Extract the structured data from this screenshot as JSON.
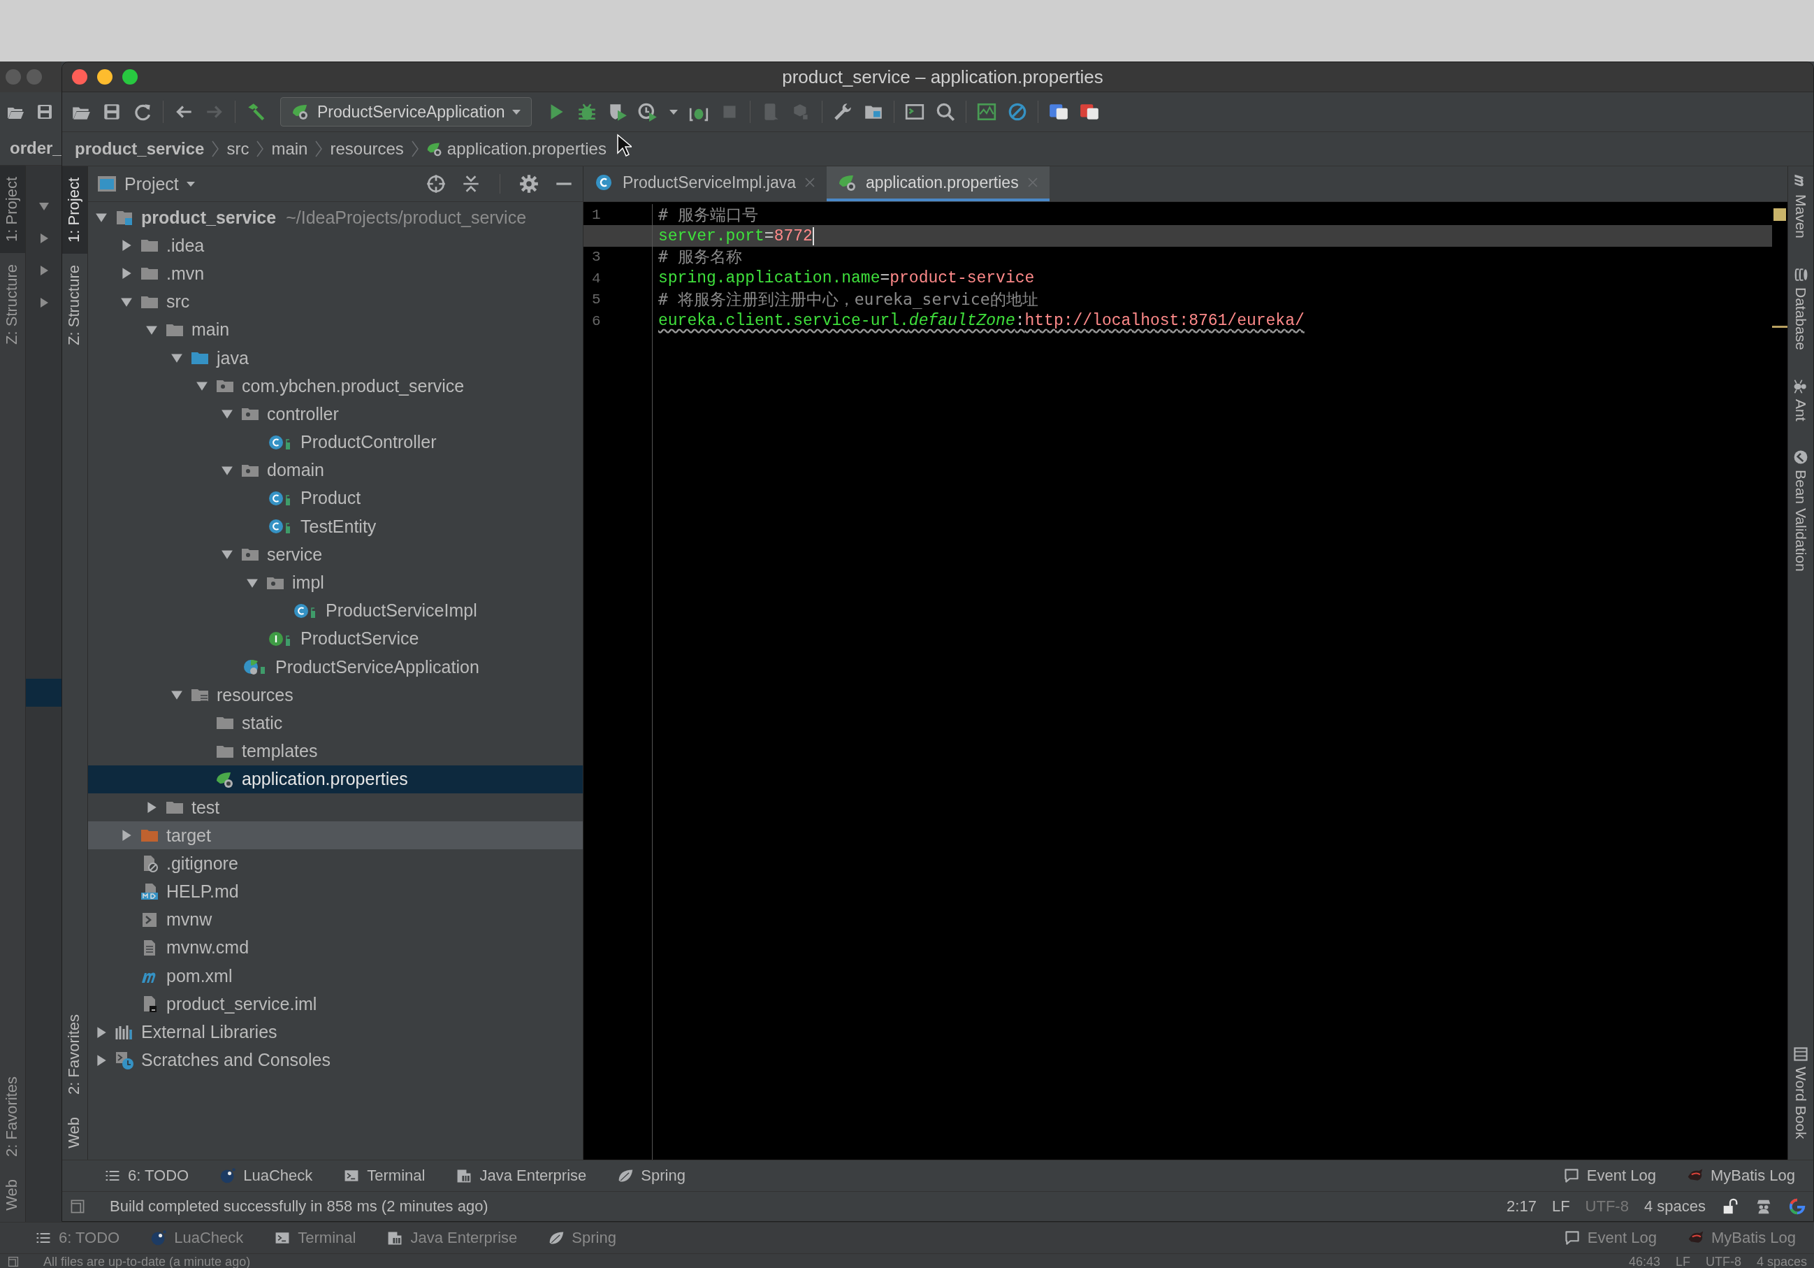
{
  "back_window": {
    "breadcrumb": "order_",
    "left_tool_tabs": [
      {
        "label": "1: Project",
        "selected": true
      },
      {
        "label": "Z: Structure",
        "selected": false
      }
    ],
    "left_tool_tabs_bottom": [
      {
        "label": "2: Favorites",
        "selected": false
      },
      {
        "label": "Web",
        "selected": false
      }
    ],
    "tool_buttons": [
      {
        "label": "6: TODO",
        "kind": "todo"
      },
      {
        "label": "LuaCheck",
        "kind": "lua"
      },
      {
        "label": "Terminal",
        "kind": "terminal"
      },
      {
        "label": "Java Enterprise",
        "kind": "enterprise"
      },
      {
        "label": "Spring",
        "kind": "spring"
      }
    ],
    "tool_buttons_right": [
      {
        "label": "Event Log",
        "kind": "event"
      },
      {
        "label": "MyBatis Log",
        "kind": "mybatis"
      }
    ],
    "status": "All files are up-to-date (a minute ago)",
    "status_right": [
      {
        "text": "46:43"
      },
      {
        "text": "LF"
      },
      {
        "text": "UTF-8"
      },
      {
        "text": "4 spaces"
      }
    ]
  },
  "window": {
    "title": "product_service – application.properties"
  },
  "run_configuration": {
    "label": "ProductServiceApplication"
  },
  "breadcrumb": [
    {
      "label": "product_service",
      "kind": "project"
    },
    {
      "label": "src",
      "kind": "folder"
    },
    {
      "label": "main",
      "kind": "folder"
    },
    {
      "label": "resources",
      "kind": "folder"
    },
    {
      "label": "application.properties",
      "kind": "spring-file"
    }
  ],
  "left_tool_tabs": [
    {
      "label": "1: Project",
      "selected": true
    },
    {
      "label": "Z: Structure",
      "selected": false
    }
  ],
  "left_tool_tabs_bottom": [
    {
      "label": "2: Favorites",
      "selected": false
    },
    {
      "label": "Web",
      "selected": false
    }
  ],
  "project_panel": {
    "title": "Project",
    "tree": [
      {
        "label": "product_service",
        "path": "~/IdeaProjects/product_service",
        "kind": "module",
        "expanded": true,
        "selected": false,
        "hovered": false,
        "children": [
          {
            "label": ".idea",
            "kind": "folder",
            "expanded": false,
            "selected": false,
            "hovered": false
          },
          {
            "label": ".mvn",
            "kind": "folder",
            "expanded": false,
            "selected": false,
            "hovered": false
          },
          {
            "label": "src",
            "kind": "folder",
            "expanded": true,
            "selected": false,
            "hovered": false,
            "children": [
              {
                "label": "main",
                "kind": "folder",
                "expanded": true,
                "selected": false,
                "hovered": false,
                "children": [
                  {
                    "label": "java",
                    "kind": "source-root",
                    "expanded": true,
                    "selected": false,
                    "hovered": false,
                    "children": [
                      {
                        "label": "com.ybchen.product_service",
                        "kind": "package",
                        "expanded": true,
                        "selected": false,
                        "hovered": false,
                        "children": [
                          {
                            "label": "controller",
                            "kind": "package",
                            "expanded": true,
                            "selected": false,
                            "hovered": false,
                            "children": [
                              {
                                "label": "ProductController",
                                "kind": "class",
                                "selected": false,
                                "hovered": false
                              }
                            ]
                          },
                          {
                            "label": "domain",
                            "kind": "package",
                            "expanded": true,
                            "selected": false,
                            "hovered": false,
                            "children": [
                              {
                                "label": "Product",
                                "kind": "class",
                                "selected": false,
                                "hovered": false
                              },
                              {
                                "label": "TestEntity",
                                "kind": "class",
                                "selected": false,
                                "hovered": false
                              }
                            ]
                          },
                          {
                            "label": "service",
                            "kind": "package",
                            "expanded": true,
                            "selected": false,
                            "hovered": false,
                            "children": [
                              {
                                "label": "impl",
                                "kind": "package",
                                "expanded": true,
                                "selected": false,
                                "hovered": false,
                                "children": [
                                  {
                                    "label": "ProductServiceImpl",
                                    "kind": "class",
                                    "selected": false,
                                    "hovered": false
                                  }
                                ]
                              },
                              {
                                "label": "ProductService",
                                "kind": "interface",
                                "selected": false,
                                "hovered": false
                              }
                            ]
                          },
                          {
                            "label": "ProductServiceApplication",
                            "kind": "spring-class",
                            "selected": false,
                            "hovered": false
                          }
                        ]
                      }
                    ]
                  },
                  {
                    "label": "resources",
                    "kind": "resources",
                    "expanded": true,
                    "selected": false,
                    "hovered": false,
                    "children": [
                      {
                        "label": "static",
                        "kind": "folder",
                        "selected": false,
                        "hovered": false
                      },
                      {
                        "label": "templates",
                        "kind": "folder",
                        "selected": false,
                        "hovered": false
                      },
                      {
                        "label": "application.properties",
                        "kind": "spring-file",
                        "selected": true,
                        "hovered": false
                      }
                    ]
                  }
                ]
              },
              {
                "label": "test",
                "kind": "folder",
                "expanded": false,
                "selected": false,
                "hovered": false
              }
            ]
          },
          {
            "label": "target",
            "kind": "excluded",
            "expanded": false,
            "selected": false,
            "hovered": true
          },
          {
            "label": ".gitignore",
            "kind": "ignore-file",
            "selected": false,
            "hovered": false
          },
          {
            "label": "HELP.md",
            "kind": "markdown",
            "selected": false,
            "hovered": false
          },
          {
            "label": "mvnw",
            "kind": "shell",
            "selected": false,
            "hovered": false
          },
          {
            "label": "mvnw.cmd",
            "kind": "text-file",
            "selected": false,
            "hovered": false
          },
          {
            "label": "pom.xml",
            "kind": "maven",
            "selected": false,
            "hovered": false
          },
          {
            "label": "product_service.iml",
            "kind": "module-file",
            "selected": false,
            "hovered": false
          }
        ]
      },
      {
        "label": "External Libraries",
        "kind": "libraries",
        "expanded": false,
        "selected": false,
        "hovered": false
      },
      {
        "label": "Scratches and Consoles",
        "kind": "scratches",
        "expanded": false,
        "selected": false,
        "hovered": false
      }
    ]
  },
  "editor": {
    "tabs": [
      {
        "label": "ProductServiceImpl.java",
        "kind": "class",
        "selected": false
      },
      {
        "label": "application.properties",
        "kind": "spring-file",
        "selected": true
      }
    ],
    "lines": [
      {
        "number": "1",
        "current": false,
        "warning": false,
        "tokens": [
          {
            "text": "# 服务端口号",
            "kind": "comment"
          }
        ]
      },
      {
        "current": true,
        "warning": false,
        "tokens": [
          {
            "text": "server.port",
            "kind": "key"
          },
          {
            "text": "=",
            "kind": "sep"
          },
          {
            "text": "8772",
            "kind": "value"
          }
        ]
      },
      {
        "number": "3",
        "current": false,
        "warning": false,
        "tokens": [
          {
            "text": "# 服务名称",
            "kind": "comment"
          }
        ]
      },
      {
        "number": "4",
        "current": false,
        "warning": false,
        "tokens": [
          {
            "text": "spring.application.name",
            "kind": "key"
          },
          {
            "text": "=",
            "kind": "sep"
          },
          {
            "text": "product-service",
            "kind": "value"
          }
        ]
      },
      {
        "number": "5",
        "current": false,
        "warning": false,
        "tokens": [
          {
            "text": "# 将服务注册到注册中心，eureka_service的地址",
            "kind": "comment"
          }
        ]
      },
      {
        "number": "6",
        "current": false,
        "warning": true,
        "tokens": [
          {
            "text": "eureka.client.service-url.",
            "kind": "key"
          },
          {
            "text": "defaultZone",
            "kind": "key-italic"
          },
          {
            "text": ":",
            "kind": "sep"
          },
          {
            "text": "http://localhost:8761/eureka/",
            "kind": "value"
          }
        ]
      }
    ]
  },
  "right_tool_tabs": [
    {
      "label": "Maven",
      "kind": "maven"
    },
    {
      "label": "Database",
      "kind": "database"
    },
    {
      "label": "Ant",
      "kind": "ant"
    },
    {
      "label": "Bean Validation",
      "kind": "bean"
    }
  ],
  "right_tool_tabs_bottom": [
    {
      "label": "Word Book",
      "kind": "book"
    }
  ],
  "tool_buttons": [
    {
      "label": "6: TODO",
      "kind": "todo"
    },
    {
      "label": "LuaCheck",
      "kind": "lua"
    },
    {
      "label": "Terminal",
      "kind": "terminal"
    },
    {
      "label": "Java Enterprise",
      "kind": "enterprise"
    },
    {
      "label": "Spring",
      "kind": "spring"
    }
  ],
  "tool_buttons_right": [
    {
      "label": "Event Log",
      "kind": "event"
    },
    {
      "label": "MyBatis Log",
      "kind": "mybatis"
    }
  ],
  "status_bar": {
    "message": "Build completed successfully in 858 ms (2 minutes ago)",
    "items": [
      {
        "text": "2:17",
        "dimmed": false
      },
      {
        "text": "LF",
        "dimmed": false
      },
      {
        "text": "UTF-8",
        "dimmed": true
      },
      {
        "text": "4 spaces",
        "dimmed": false
      }
    ]
  }
}
